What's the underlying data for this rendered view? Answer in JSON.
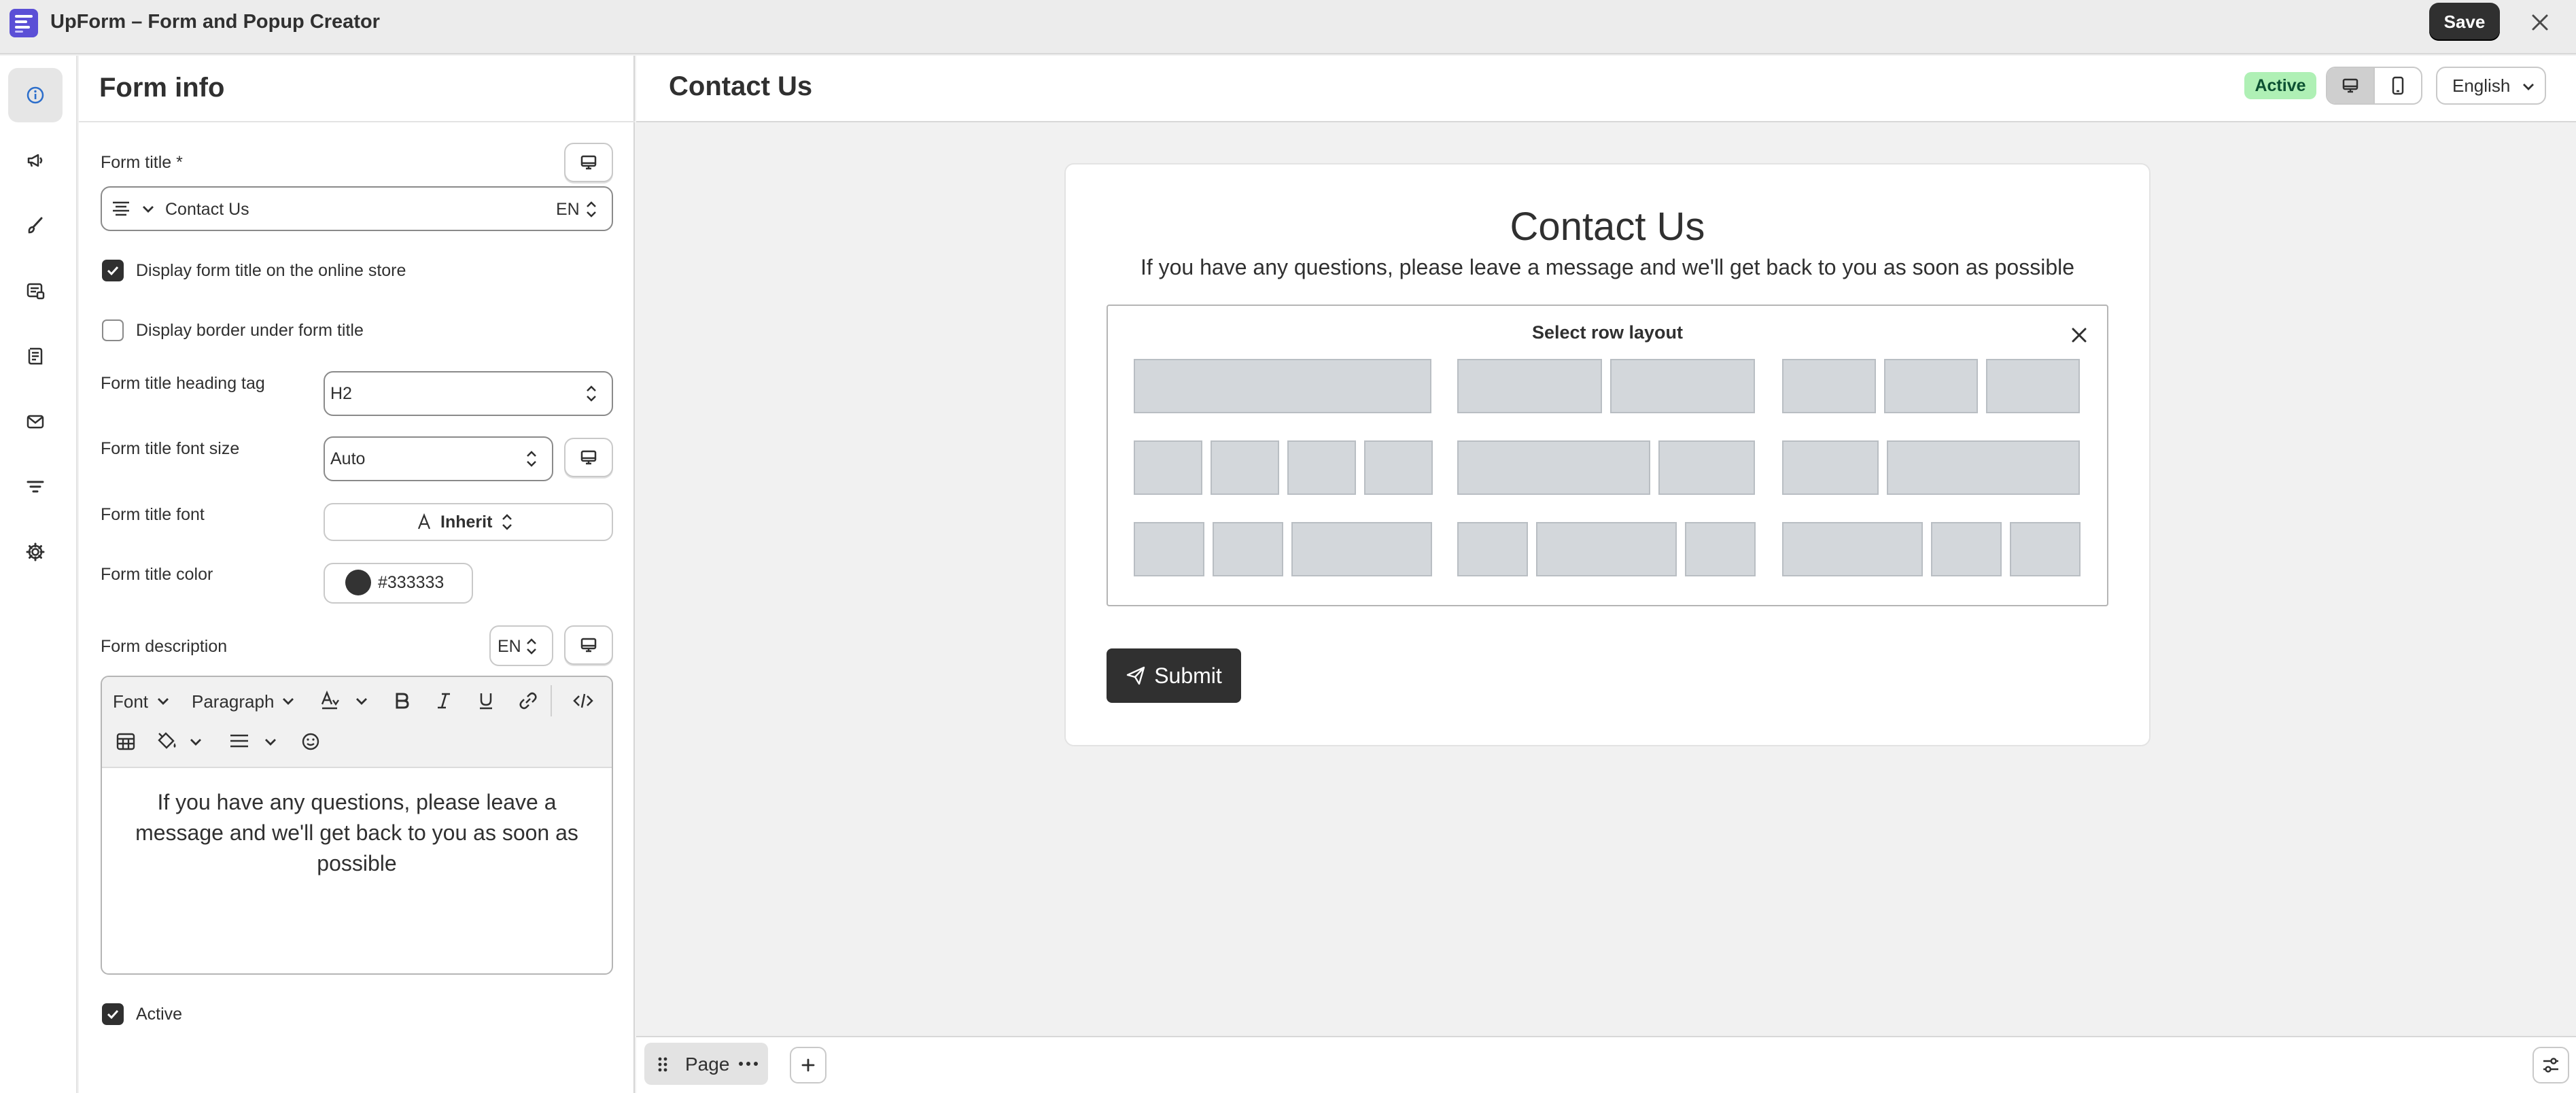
{
  "app": {
    "title": "UpForm – Form and Popup Creator",
    "save_label": "Save"
  },
  "rail": {
    "items": [
      {
        "icon": "info-icon",
        "active": true
      },
      {
        "icon": "megaphone-icon",
        "active": false
      },
      {
        "icon": "brush-icon",
        "active": false
      },
      {
        "icon": "form-list-icon",
        "active": false
      },
      {
        "icon": "checklist-icon",
        "active": false
      },
      {
        "icon": "mail-icon",
        "active": false
      },
      {
        "icon": "filter-icon",
        "active": false
      },
      {
        "icon": "gear-icon",
        "active": false
      }
    ]
  },
  "panel": {
    "title": "Form info",
    "form_title_label": "Form title *",
    "form_title_value": "Contact Us",
    "form_title_lang": "EN",
    "display_title_label": "Display form title on the online store",
    "display_title_checked": true,
    "display_border_label": "Display border under form title",
    "display_border_checked": false,
    "heading_tag_label": "Form title heading tag",
    "heading_tag_value": "H2",
    "font_size_label": "Form title font size",
    "font_size_value": "Auto",
    "font_label": "Form title font",
    "font_value": "Inherit",
    "color_label": "Form title color",
    "color_value": "#333333",
    "description_label": "Form description",
    "description_lang": "EN",
    "editor": {
      "font_label": "Font",
      "paragraph_label": "Paragraph",
      "body": "If you have any questions, please leave a message and we'll get back to you as soon as possible"
    },
    "active_label": "Active",
    "active_checked": true
  },
  "preview": {
    "title": "Contact Us",
    "status": "Active",
    "language": "English",
    "form": {
      "title": "Contact Us",
      "description": "If you have any questions, please leave a message and we'll get back to you as soon as possible",
      "layout_picker_title": "Select row layout",
      "layout_options": [
        [
          1
        ],
        [
          1,
          1
        ],
        [
          1,
          1,
          1
        ],
        [
          1,
          1,
          1,
          1
        ],
        [
          2,
          1
        ],
        [
          1,
          2
        ],
        [
          1,
          1,
          2
        ],
        [
          1,
          2,
          1
        ],
        [
          2,
          1,
          1
        ]
      ],
      "submit_label": "Submit"
    }
  },
  "page_bar": {
    "page_label": "Page"
  },
  "colors": {
    "primary": "#303030",
    "badge_bg": "#aff0b5",
    "badge_fg": "#0c5132",
    "accent_logo": "#5b4fd6"
  }
}
